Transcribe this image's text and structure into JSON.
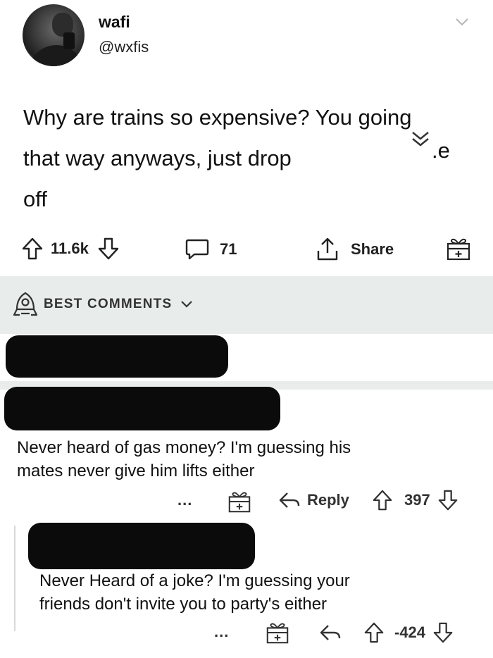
{
  "post": {
    "author": "wafi",
    "handle": "@wxfis",
    "text": "Why are trains so expensive? You going that way anyways, just drop",
    "text_tail": ".e",
    "text_line3": "off",
    "upvotes": "11.6k",
    "comments": "71",
    "share_label": "Share"
  },
  "best_comments": {
    "label": "BEST COMMENTS"
  },
  "comments": [
    {
      "text_line1": "Never heard of gas money? I'm guessing his",
      "text_line2": "mates never give him lifts either",
      "reply_label": "Reply",
      "score": "397",
      "more": "..."
    },
    {
      "text_line1": "Never Heard of a joke? I'm guessing your",
      "text_line2": "friends don't invite you to party's either",
      "score": "-424",
      "more": "..."
    }
  ],
  "colors": {
    "banner_bg": "#e8ecea",
    "redaction": "#0b0b0b",
    "text": "#111111"
  }
}
